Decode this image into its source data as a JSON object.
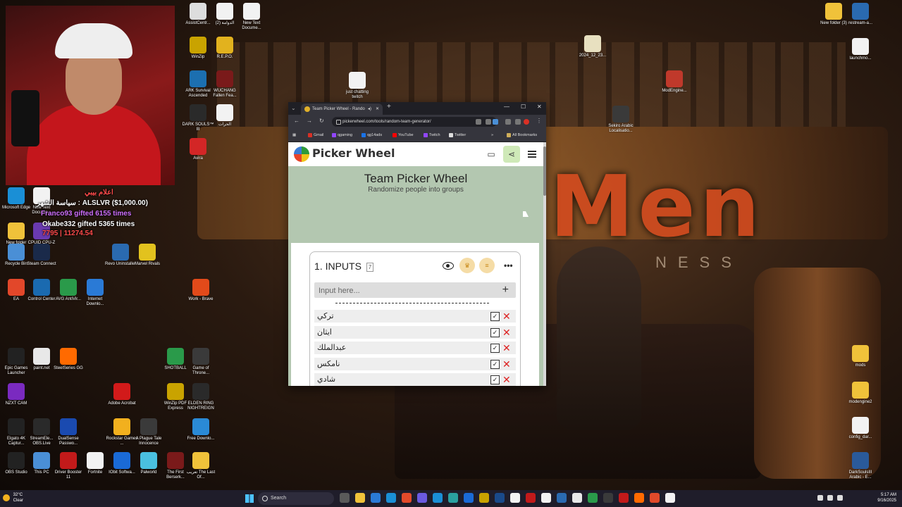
{
  "stream": {
    "overlay_lines": [
      "سياسة الشهر : ALSLVR ($1,000.00)",
      "Franco93 gifted 6155 times",
      "Okabe332 gifted 5365 times",
      "7795 | 11274.54",
      "اعلام بيبي"
    ]
  },
  "desktop": {
    "icons": [
      {
        "label": "AssistCentr...",
        "color": "#dddddd"
      },
      {
        "label": "الدوامة (2)",
        "color": "#f2f2f2"
      },
      {
        "label": "New Text Docume...",
        "color": "#f2f2f2"
      },
      {
        "label": "WinZip",
        "color": "#c9a300"
      },
      {
        "label": "R.E.P.O.",
        "color": "#e2b21e"
      },
      {
        "label": "just chatting twitch",
        "color": "#f2f2f2"
      },
      {
        "label": "ARK Survival Ascended",
        "color": "#1c6fb0"
      },
      {
        "label": "WUCHANG Fallen Fea...",
        "color": "#7a1a1a"
      },
      {
        "label": "DARK SOULS™ III",
        "color": "#2a2a2a"
      },
      {
        "label": "الحرات",
        "color": "#f2f2f2"
      },
      {
        "label": "Avira",
        "color": "#d32626"
      },
      {
        "label": "Microsoft Edge",
        "color": "#1a8fd6"
      },
      {
        "label": "New Text Docume...",
        "color": "#f2f2f2"
      },
      {
        "label": "New folder",
        "color": "#f0c23a"
      },
      {
        "label": "CPUID CPU-Z",
        "color": "#6a3ab0"
      },
      {
        "label": "Recycle Bin",
        "color": "#4a8fd6"
      },
      {
        "label": "Steam Connect",
        "color": "#1a2a4a"
      },
      {
        "label": "Revo Uninstaller",
        "color": "#2a6ab0"
      },
      {
        "label": "Marvel Rivals",
        "color": "#e2c21e"
      },
      {
        "label": "EA",
        "color": "#e2472a"
      },
      {
        "label": "Control Center",
        "color": "#1a6ab0"
      },
      {
        "label": "AVG AntiVir...",
        "color": "#2a9a4a"
      },
      {
        "label": "Internet Downlo...",
        "color": "#2a7ad6"
      },
      {
        "label": "Epic Games Launcher",
        "color": "#222222"
      },
      {
        "label": "paint.net",
        "color": "#e8e8e8"
      },
      {
        "label": "SteelSeries GG",
        "color": "#ff6a00"
      },
      {
        "label": "NZXT CAM",
        "color": "#7a2ac0"
      },
      {
        "label": "Elgato 4K Captur...",
        "color": "#222222"
      },
      {
        "label": "StreamEle... OBS.Live",
        "color": "#2a2a2a"
      },
      {
        "label": "DualSense Passwo...",
        "color": "#1a4ab0"
      },
      {
        "label": "OBS Studio",
        "color": "#222222"
      },
      {
        "label": "This PC",
        "color": "#4a8fd6"
      },
      {
        "label": "Driver Booster 11",
        "color": "#c21a1a"
      },
      {
        "label": "Fortnite",
        "color": "#f2f2f2"
      },
      {
        "label": "IObit Softwa...",
        "color": "#1a6ad6"
      },
      {
        "label": "Palworld",
        "color": "#4ac0e0"
      },
      {
        "label": "The First Berserk...",
        "color": "#7a1a1a"
      },
      {
        "label": "تعريب The Last Of...",
        "color": "#f0c23a"
      },
      {
        "label": "Work - Brave",
        "color": "#e24a1a"
      },
      {
        "label": "SHOTBALL",
        "color": "#2a9a4a"
      },
      {
        "label": "Game of Throne...",
        "color": "#3a3a3a"
      },
      {
        "label": "Free Downlo...",
        "color": "#2a8ad6"
      },
      {
        "label": "WinZip PDF Express",
        "color": "#c9a300"
      },
      {
        "label": "ELDEN RING NIGHTREIGN",
        "color": "#2a2a2a"
      },
      {
        "label": "Adobe Acrobat",
        "color": "#d21a1a"
      },
      {
        "label": "Rockstar Games ...",
        "color": "#f2b01e"
      },
      {
        "label": "A Plague Tale Innocence",
        "color": "#3a3a3a"
      },
      {
        "label": "New folder (3)",
        "color": "#f0c23a"
      },
      {
        "label": "restream-a...",
        "color": "#2a6ab0"
      },
      {
        "label": "launchmo...",
        "color": "#f2f2f2"
      },
      {
        "label": "2024_12_23...",
        "color": "#e8e0c0"
      },
      {
        "label": "ModEngine...",
        "color": "#c0392b"
      },
      {
        "label": "Sekiro Arabic Localisatio...",
        "color": "#3a3a3a"
      },
      {
        "label": "mods",
        "color": "#f0c23a"
      },
      {
        "label": "modengine2",
        "color": "#f0c23a"
      },
      {
        "label": "config_dar...",
        "color": "#f2f2f2"
      },
      {
        "label": "DarkSoulsIII Arabic - E...",
        "color": "#2a5a9a"
      }
    ]
  },
  "taskbar": {
    "weather_temp": "32°C",
    "weather_desc": "Clear",
    "search_placeholder": "Search",
    "time": "5:17 AM",
    "date": "9/16/2025",
    "apps": [
      "#5a5a5a",
      "#f0c23a",
      "#2a7ad6",
      "#1a8fd6",
      "#e24a2a",
      "#6a5ae0",
      "#1a8fd6",
      "#2aa0a0",
      "#1a6ad6",
      "#c9a300",
      "#1a4a8a",
      "#f2f2f2",
      "#c21a1a",
      "#f2f2f2",
      "#2a6ab0",
      "#e8e8e8",
      "#2a9a4a",
      "#3a3a3a",
      "#c21a1a",
      "#ff6a00",
      "#e24a2a",
      "#f2f2f2"
    ]
  },
  "browser": {
    "tab_title": "Team Picker Wheel - Rando",
    "url": "pickerwheel.com/tools/random-team-generator/",
    "bookmarks": [
      {
        "label": "Gmail",
        "color": "#d93025"
      },
      {
        "label": "qgaming",
        "color": "#9146ff"
      },
      {
        "label": "qg14ads",
        "color": "#1a73e8"
      },
      {
        "label": "YouTube",
        "color": "#ff0000"
      },
      {
        "label": "Twitch",
        "color": "#9146ff"
      },
      {
        "label": "Twitter",
        "color": "#dddddd"
      }
    ],
    "all_bookmarks": "All Bookmarks"
  },
  "page": {
    "brand": "Picker Wheel",
    "title": "Team Picker Wheel",
    "subtitle": "Randomize people into groups",
    "inputs_title": "1. INPUTS",
    "inputs_count": "7",
    "input_placeholder": "Input here...",
    "entries": [
      {
        "name": "تركي",
        "checked": true
      },
      {
        "name": "ايثان",
        "checked": true
      },
      {
        "name": "عبدالملك",
        "checked": true
      },
      {
        "name": "نامكس",
        "checked": true
      },
      {
        "name": "شادي",
        "checked": true
      }
    ],
    "colors": {
      "accent": "#b3c7b0",
      "share_bg": "#cfe9b8",
      "remove": "#dd2222"
    }
  }
}
